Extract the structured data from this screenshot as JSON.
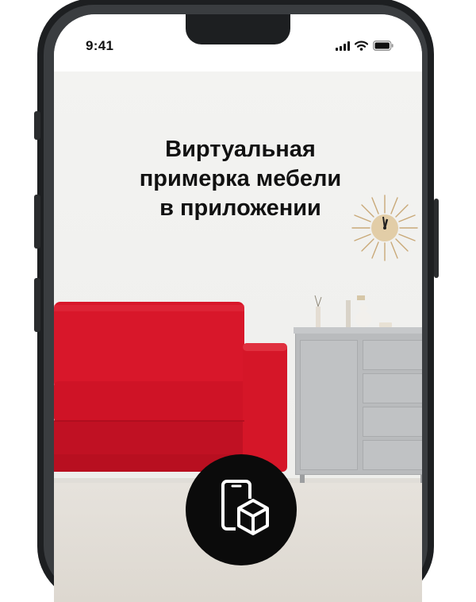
{
  "status_bar": {
    "time": "9:41",
    "icons": [
      "signal-icon",
      "wifi-icon",
      "battery-icon"
    ]
  },
  "promo": {
    "headline_lines": [
      "Виртуальная",
      "примерка мебели",
      "в приложении"
    ]
  },
  "badge": {
    "icon": "ar-phone-cube-icon"
  },
  "colors": {
    "sofa": "#e0182a",
    "cabinet": "#b9bbbd",
    "badge": "#0b0b0b",
    "phone_frame": "#1d1f21"
  }
}
